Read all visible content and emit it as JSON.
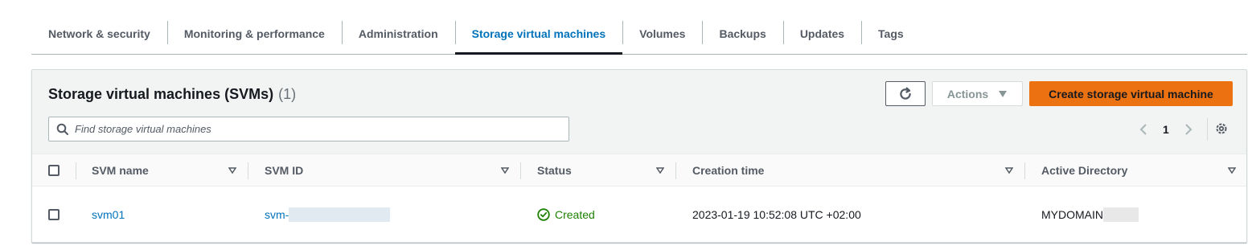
{
  "tabs": [
    {
      "label": "Network & security"
    },
    {
      "label": "Monitoring & performance"
    },
    {
      "label": "Administration"
    },
    {
      "label": "Storage virtual machines",
      "active": true
    },
    {
      "label": "Volumes"
    },
    {
      "label": "Backups"
    },
    {
      "label": "Updates"
    },
    {
      "label": "Tags"
    }
  ],
  "panel": {
    "title": "Storage virtual machines (SVMs)",
    "count": "(1)",
    "actions_label": "Actions",
    "create_label": "Create storage virtual machine",
    "search": {
      "placeholder": "Find storage virtual machines",
      "value": ""
    },
    "pagination": {
      "current_page": "1"
    }
  },
  "table": {
    "columns": [
      "SVM name",
      "SVM ID",
      "Status",
      "Creation time",
      "Active Directory"
    ],
    "rows": [
      {
        "svm_name": "svm01",
        "svm_id": "svm-",
        "status": "Created",
        "creation_time": "2023-01-19 10:52:08 UTC +02:00",
        "active_directory": "MYDOMAIN"
      }
    ]
  },
  "colors": {
    "accent": "#0073bb",
    "primary_button": "#ec7211",
    "status_ok": "#1d8102"
  },
  "icons": [
    "refresh-icon",
    "caret-down-icon",
    "search-icon",
    "chevron-left-icon",
    "chevron-right-icon",
    "gear-icon",
    "sort-icon",
    "status-ok-icon"
  ]
}
